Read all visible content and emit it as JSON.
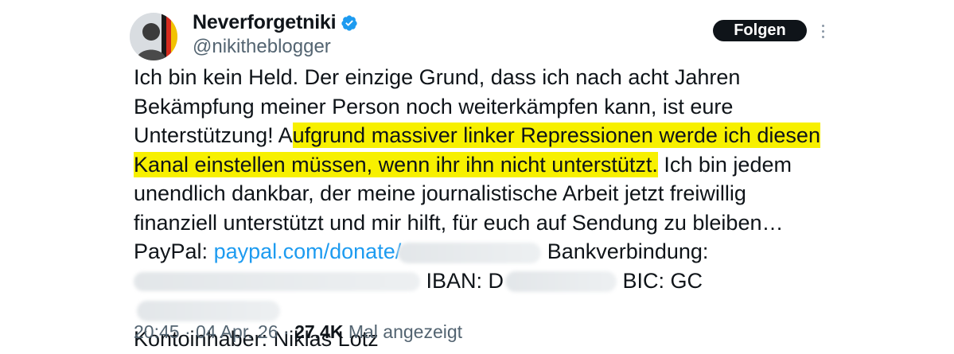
{
  "author": {
    "display_name": "Neverforgetniki",
    "handle": "@nikitheblogger",
    "verified": true,
    "avatar_icon": "profile-photo",
    "verified_icon": "verified-badge-icon"
  },
  "actions": {
    "follow_label": "Folgen",
    "more_icon": "more-vertical-icon"
  },
  "tweet": {
    "text_part1": "Ich bin kein Held. Der einzige Grund, dass ich nach acht Jahren Bekämpfung meiner Person noch weiterkämpfen kann, ist eure Unterstützung! A",
    "text_highlighted": "ufgrund massiver linker Repressionen werde ich diesen Kanal einstellen müssen, wenn ihr ihn nicht unterstützt.",
    "text_part2": " Ich bin jedem unendlich dankbar, der meine journalistische Arbeit jetzt freiwillig finanziell unterstützt und mir hilft, für euch auf Sendung zu bleiben… PayPal: ",
    "paypal_link_visible": "paypal.com/donate/",
    "text_bank": " Bankverbindung: ",
    "iban_label": "IBAN: D",
    "bic_label": " BIC: GC",
    "owner_line": "Kontoinhaber: Niklas Lotz"
  },
  "meta": {
    "time": "20:45",
    "separator": "·",
    "date": "04 Apr. 26",
    "views_count": "27,4K",
    "views_label": "Mal angezeigt"
  },
  "colors": {
    "highlight": "#f7f000",
    "link": "#1d9bf0",
    "verified": "#1d9bf0",
    "follow_bg": "#0f1419"
  }
}
